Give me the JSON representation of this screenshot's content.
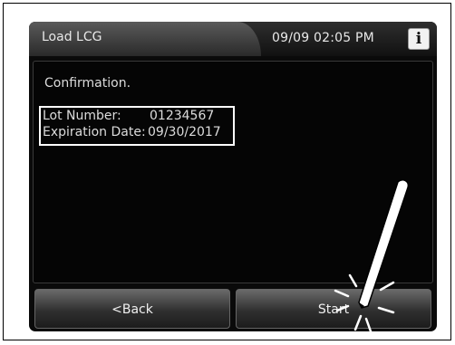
{
  "header": {
    "title": "Load LCG",
    "datetime": "09/09 02:05 PM",
    "info_glyph": "i"
  },
  "content": {
    "message": "Confirmation.",
    "lot_label": "Lot Number:",
    "lot_value": "01234567",
    "expiration_label": "Expiration Date:",
    "expiration_value": "09/30/2017"
  },
  "buttons": {
    "back_label": "<Back",
    "start_label": "Start"
  },
  "icons": {
    "info": "info-icon",
    "stylus": "stylus-icon",
    "tap": "tap-indicator-icon"
  },
  "colors": {
    "screen_bg": "#0a0a0a",
    "text": "#dcdcdc",
    "highlight": "#ffffff"
  }
}
